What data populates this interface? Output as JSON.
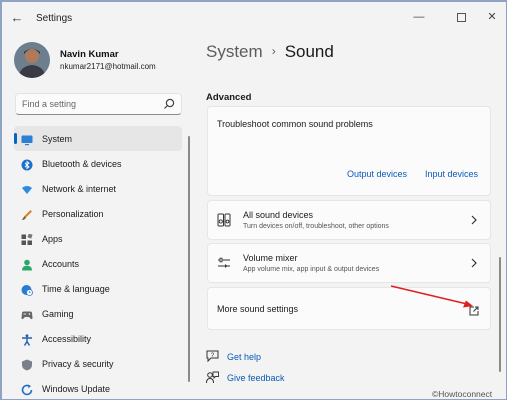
{
  "window": {
    "title": "Settings"
  },
  "user": {
    "name": "Navin Kumar",
    "email": "nkumar2171@hotmail.com"
  },
  "search": {
    "placeholder": "Find a setting"
  },
  "nav": {
    "items": [
      {
        "label": "System",
        "icon": "monitor-icon",
        "selected": true
      },
      {
        "label": "Bluetooth & devices",
        "icon": "bluetooth-icon"
      },
      {
        "label": "Network & internet",
        "icon": "wifi-icon"
      },
      {
        "label": "Personalization",
        "icon": "brush-icon"
      },
      {
        "label": "Apps",
        "icon": "apps-icon"
      },
      {
        "label": "Accounts",
        "icon": "person-icon"
      },
      {
        "label": "Time & language",
        "icon": "globe-clock-icon"
      },
      {
        "label": "Gaming",
        "icon": "gamepad-icon"
      },
      {
        "label": "Accessibility",
        "icon": "accessibility-icon"
      },
      {
        "label": "Privacy & security",
        "icon": "shield-icon"
      },
      {
        "label": "Windows Update",
        "icon": "update-icon"
      }
    ]
  },
  "breadcrumb": {
    "parent": "System",
    "separator": "›",
    "current": "Sound"
  },
  "advanced": {
    "section_title": "Advanced",
    "troubleshoot": {
      "title": "Troubleshoot common sound problems",
      "output_link": "Output devices",
      "input_link": "Input devices"
    },
    "all_devices": {
      "title": "All sound devices",
      "subtitle": "Turn devices on/off, troubleshoot, other options"
    },
    "volume_mixer": {
      "title": "Volume mixer",
      "subtitle": "App volume mix, app input & output devices"
    },
    "more_settings": {
      "title": "More sound settings"
    }
  },
  "footer": {
    "help": "Get help",
    "feedback": "Give feedback"
  },
  "watermark": "©Howtoconnect",
  "colors": {
    "accent": "#0067c0",
    "link": "#0a5ab8",
    "annotation_arrow": "#e02020"
  }
}
